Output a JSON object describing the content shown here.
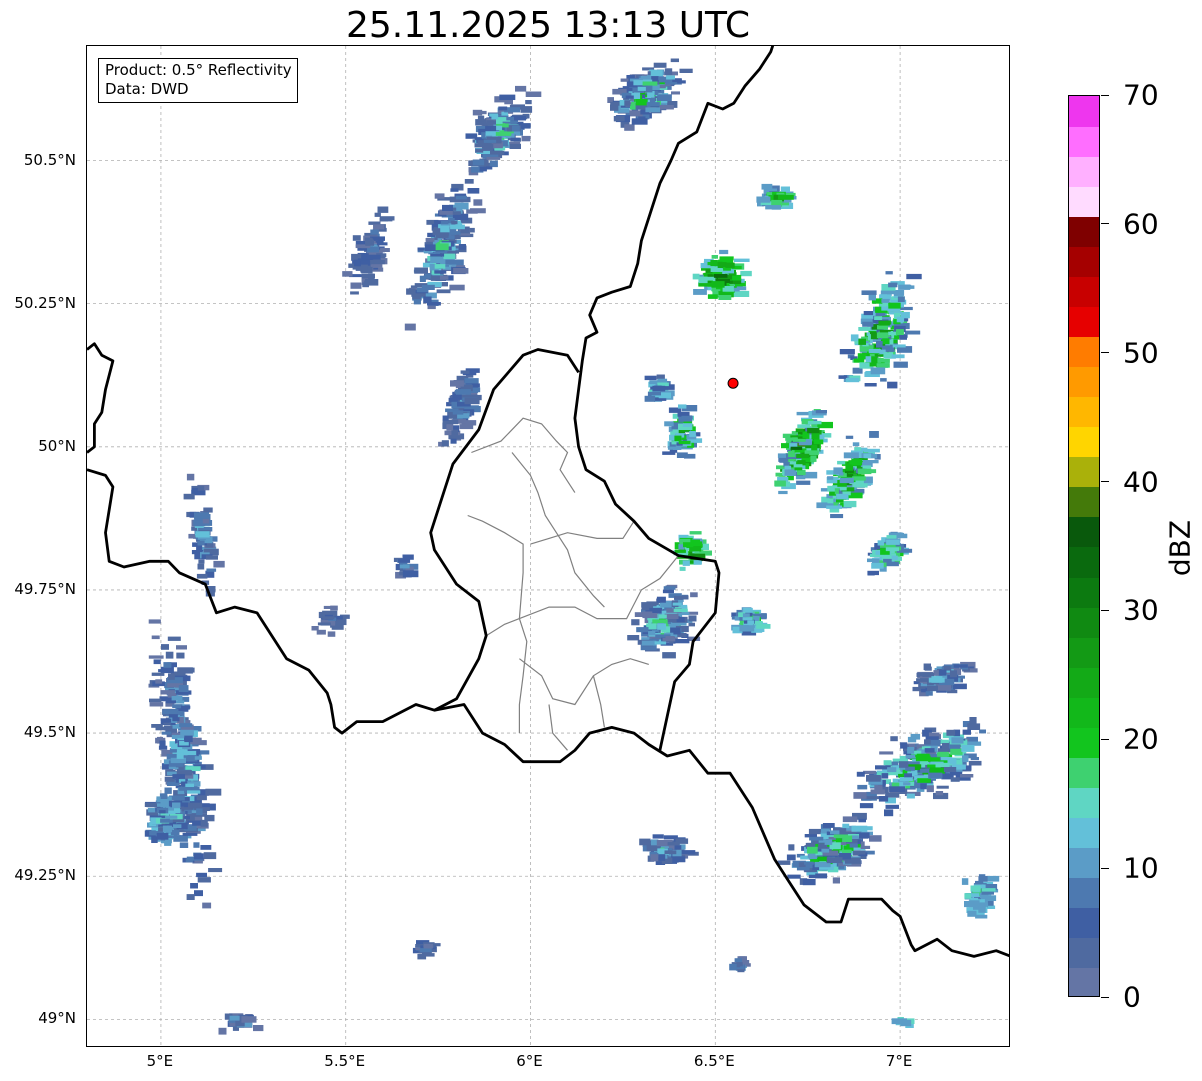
{
  "title": "25.11.2025 13:13 UTC",
  "info": {
    "product": "Product: 0.5° Reflectivity",
    "data": "Data: DWD"
  },
  "axes": {
    "lon_min": 4.8,
    "lon_max": 7.3,
    "lat_min": 48.95,
    "lat_max": 50.7,
    "x_ticks": [
      {
        "value": 5.0,
        "label": "5°E"
      },
      {
        "value": 5.5,
        "label": "5.5°E"
      },
      {
        "value": 6.0,
        "label": "6°E"
      },
      {
        "value": 6.5,
        "label": "6.5°E"
      },
      {
        "value": 7.0,
        "label": "7°E"
      }
    ],
    "y_ticks": [
      {
        "value": 49.0,
        "label": "49°N"
      },
      {
        "value": 49.25,
        "label": "49.25°N"
      },
      {
        "value": 49.5,
        "label": "49.5°N"
      },
      {
        "value": 49.75,
        "label": "49.75°N"
      },
      {
        "value": 50.0,
        "label": "50°N"
      },
      {
        "value": 50.25,
        "label": "50.25°N"
      },
      {
        "value": 50.5,
        "label": "50.5°N"
      }
    ],
    "grid": true
  },
  "radar_site": {
    "lon": 6.548,
    "lat": 50.111,
    "color": "#ff0000"
  },
  "colorbar": {
    "label": "dBZ",
    "min": 0,
    "max": 70,
    "ticks": [
      {
        "value": 0,
        "label": "0"
      },
      {
        "value": 10,
        "label": "10"
      },
      {
        "value": 20,
        "label": "20"
      },
      {
        "value": 30,
        "label": "30"
      },
      {
        "value": 40,
        "label": "40"
      },
      {
        "value": 50,
        "label": "50"
      },
      {
        "value": 60,
        "label": "60"
      },
      {
        "value": 70,
        "label": "70"
      }
    ],
    "colors": [
      "#6475a5",
      "#4f6aa0",
      "#3f5fa3",
      "#4d79b0",
      "#5b9cc7",
      "#63c0d9",
      "#5fd6c3",
      "#3ed170",
      "#12c51e",
      "#12b81a",
      "#13aa17",
      "#139a15",
      "#108a12",
      "#0c7a10",
      "#0a6a0e",
      "#09590c",
      "#447a0a",
      "#aab10a",
      "#ffd500",
      "#ffb700",
      "#ff9a00",
      "#ff7c00",
      "#e60000",
      "#c80000",
      "#a50000",
      "#7f0000",
      "#ffdbff",
      "#ffb0ff",
      "#ff6eff",
      "#ee36ee"
    ]
  },
  "borders": {
    "country": [
      [
        [
          4.8,
          50.17
        ],
        [
          4.82,
          50.18
        ],
        [
          4.84,
          50.16
        ],
        [
          4.87,
          50.15
        ],
        [
          4.85,
          50.1
        ],
        [
          4.84,
          50.06
        ],
        [
          4.82,
          50.04
        ],
        [
          4.82,
          50.0
        ],
        [
          4.8,
          49.99
        ]
      ],
      [
        [
          4.8,
          49.96
        ],
        [
          4.85,
          49.95
        ],
        [
          4.87,
          49.93
        ],
        [
          4.86,
          49.89
        ],
        [
          4.85,
          49.85
        ],
        [
          4.86,
          49.8
        ],
        [
          4.9,
          49.79
        ],
        [
          4.97,
          49.8
        ],
        [
          5.02,
          49.8
        ],
        [
          5.05,
          49.78
        ],
        [
          5.12,
          49.76
        ],
        [
          5.15,
          49.71
        ],
        [
          5.2,
          49.72
        ],
        [
          5.26,
          49.71
        ],
        [
          5.31,
          49.66
        ],
        [
          5.34,
          49.63
        ],
        [
          5.4,
          49.61
        ],
        [
          5.45,
          49.57
        ],
        [
          5.46,
          49.55
        ],
        [
          5.47,
          49.51
        ],
        [
          5.49,
          49.5
        ],
        [
          5.53,
          49.52
        ],
        [
          5.6,
          49.52
        ],
        [
          5.69,
          49.55
        ],
        [
          5.74,
          49.54
        ],
        [
          5.82,
          49.55
        ],
        [
          5.87,
          49.5
        ],
        [
          5.93,
          49.48
        ],
        [
          5.98,
          49.45
        ],
        [
          6.03,
          49.45
        ],
        [
          6.08,
          49.45
        ],
        [
          6.12,
          49.47
        ],
        [
          6.16,
          49.5
        ],
        [
          6.22,
          49.51
        ],
        [
          6.28,
          49.5
        ],
        [
          6.32,
          49.48
        ],
        [
          6.37,
          49.46
        ],
        [
          6.43,
          49.47
        ],
        [
          6.48,
          49.43
        ],
        [
          6.54,
          49.43
        ],
        [
          6.58,
          49.39
        ],
        [
          6.6,
          49.37
        ],
        [
          6.62,
          49.34
        ],
        [
          6.66,
          49.28
        ],
        [
          6.7,
          49.24
        ],
        [
          6.74,
          49.2
        ],
        [
          6.8,
          49.17
        ],
        [
          6.84,
          49.17
        ],
        [
          6.86,
          49.21
        ],
        [
          6.9,
          49.21
        ],
        [
          6.95,
          49.21
        ],
        [
          6.98,
          49.19
        ],
        [
          7.0,
          49.18
        ],
        [
          7.03,
          49.13
        ],
        [
          7.04,
          49.12
        ],
        [
          7.1,
          49.14
        ],
        [
          7.14,
          49.12
        ],
        [
          7.2,
          49.11
        ],
        [
          7.26,
          49.12
        ],
        [
          7.3,
          49.11
        ]
      ],
      [
        [
          6.67,
          50.73
        ],
        [
          6.65,
          50.69
        ],
        [
          6.62,
          50.66
        ],
        [
          6.58,
          50.63
        ],
        [
          6.55,
          50.6
        ],
        [
          6.52,
          50.59
        ],
        [
          6.48,
          50.6
        ],
        [
          6.45,
          50.55
        ],
        [
          6.4,
          50.53
        ],
        [
          6.38,
          50.5
        ],
        [
          6.35,
          50.46
        ],
        [
          6.33,
          50.42
        ],
        [
          6.3,
          50.36
        ],
        [
          6.29,
          50.32
        ],
        [
          6.27,
          50.28
        ],
        [
          6.22,
          50.27
        ],
        [
          6.18,
          50.26
        ],
        [
          6.16,
          50.23
        ],
        [
          6.18,
          50.2
        ],
        [
          6.15,
          50.19
        ],
        [
          6.14,
          50.15
        ],
        [
          6.13,
          50.1
        ],
        [
          6.12,
          50.05
        ],
        [
          6.13,
          50.0
        ],
        [
          6.15,
          49.96
        ],
        [
          6.2,
          49.94
        ],
        [
          6.23,
          49.9
        ],
        [
          6.28,
          49.87
        ],
        [
          6.32,
          49.84
        ],
        [
          6.4,
          49.81
        ],
        [
          6.5,
          49.8
        ],
        [
          6.51,
          49.78
        ],
        [
          6.5,
          49.71
        ],
        [
          6.44,
          49.66
        ],
        [
          6.43,
          49.62
        ],
        [
          6.39,
          49.59
        ],
        [
          6.37,
          49.53
        ],
        [
          6.35,
          49.47
        ]
      ],
      [
        [
          5.74,
          49.54
        ],
        [
          5.8,
          49.56
        ],
        [
          5.86,
          49.63
        ],
        [
          5.88,
          49.67
        ],
        [
          5.86,
          49.73
        ],
        [
          5.8,
          49.76
        ],
        [
          5.74,
          49.82
        ],
        [
          5.73,
          49.85
        ],
        [
          5.76,
          49.91
        ],
        [
          5.79,
          49.97
        ],
        [
          5.86,
          50.03
        ],
        [
          5.9,
          50.1
        ],
        [
          5.98,
          50.16
        ],
        [
          6.02,
          50.17
        ],
        [
          6.1,
          50.16
        ],
        [
          6.13,
          50.13
        ]
      ]
    ],
    "admin": [
      [
        [
          5.83,
          49.88
        ],
        [
          5.87,
          49.87
        ],
        [
          5.93,
          49.85
        ],
        [
          5.98,
          49.83
        ],
        [
          5.98,
          49.78
        ],
        [
          5.97,
          49.7
        ],
        [
          5.99,
          49.66
        ],
        [
          5.98,
          49.6
        ],
        [
          5.97,
          49.55
        ],
        [
          5.97,
          49.5
        ]
      ],
      [
        [
          5.88,
          49.67
        ],
        [
          5.93,
          49.69
        ],
        [
          5.97,
          49.7
        ],
        [
          6.05,
          49.72
        ],
        [
          6.12,
          49.72
        ],
        [
          6.18,
          49.7
        ],
        [
          6.26,
          49.7
        ],
        [
          6.3,
          49.75
        ],
        [
          6.35,
          49.77
        ],
        [
          6.4,
          49.81
        ]
      ],
      [
        [
          6.0,
          49.83
        ],
        [
          6.05,
          49.84
        ],
        [
          6.1,
          49.85
        ],
        [
          6.18,
          49.84
        ],
        [
          6.25,
          49.84
        ],
        [
          6.28,
          49.87
        ]
      ],
      [
        [
          5.95,
          49.99
        ],
        [
          6.0,
          49.95
        ],
        [
          6.02,
          49.92
        ],
        [
          6.04,
          49.88
        ],
        [
          6.07,
          49.85
        ],
        [
          6.1,
          49.82
        ],
        [
          6.12,
          49.78
        ],
        [
          6.17,
          49.74
        ],
        [
          6.2,
          49.72
        ]
      ],
      [
        [
          5.84,
          49.99
        ],
        [
          5.92,
          50.01
        ],
        [
          5.98,
          50.05
        ],
        [
          6.03,
          50.04
        ],
        [
          6.07,
          50.01
        ],
        [
          6.1,
          49.99
        ],
        [
          6.08,
          49.96
        ],
        [
          6.1,
          49.94
        ],
        [
          6.12,
          49.92
        ]
      ],
      [
        [
          5.97,
          49.63
        ],
        [
          6.03,
          49.6
        ],
        [
          6.06,
          49.56
        ],
        [
          6.12,
          49.55
        ],
        [
          6.17,
          49.6
        ],
        [
          6.22,
          49.62
        ],
        [
          6.27,
          49.63
        ],
        [
          6.32,
          49.62
        ]
      ],
      [
        [
          6.05,
          49.55
        ],
        [
          6.06,
          49.5
        ],
        [
          6.1,
          49.47
        ]
      ],
      [
        [
          6.17,
          49.6
        ],
        [
          6.19,
          49.55
        ],
        [
          6.2,
          49.51
        ]
      ]
    ]
  }
}
